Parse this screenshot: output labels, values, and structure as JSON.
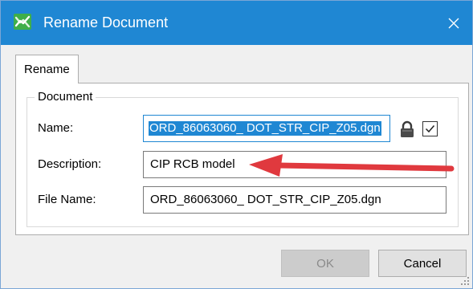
{
  "window": {
    "title": "Rename Document",
    "icon": "app-logo-icon",
    "close_icon": "close-icon"
  },
  "tabs": [
    {
      "label": "Rename",
      "active": true
    }
  ],
  "group": {
    "legend": "Document"
  },
  "fields": {
    "name": {
      "label": "Name:",
      "value": "ORD_86063060_ DOT_STR_CIP_Z05.dgn",
      "selected": true
    },
    "description": {
      "label": "Description:",
      "value": "CIP RCB model"
    },
    "file_name": {
      "label": "File Name:",
      "value": "ORD_86063060_ DOT_STR_CIP_Z05.dgn"
    }
  },
  "lock": {
    "icon": "lock-icon",
    "checked": true
  },
  "buttons": {
    "ok": "OK",
    "cancel": "Cancel"
  },
  "colors": {
    "titlebar": "#1f87d3",
    "selection": "#1f87d3",
    "annotation_arrow": "#e0393e"
  }
}
